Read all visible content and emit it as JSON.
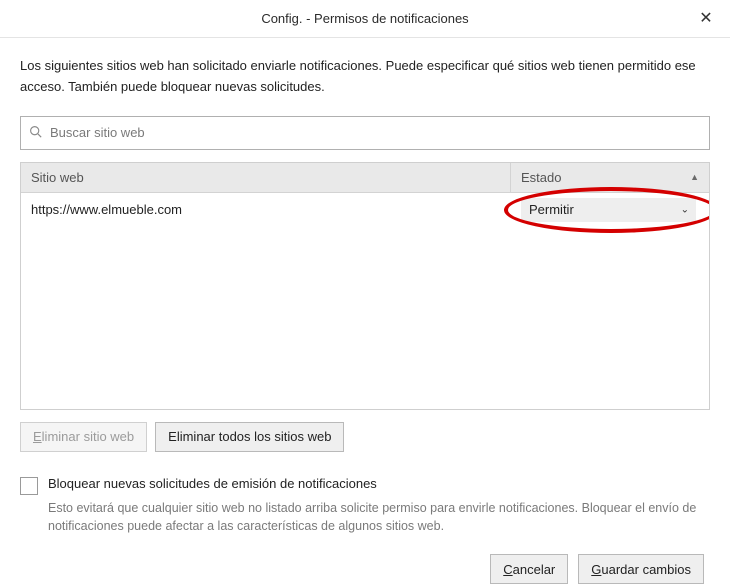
{
  "titlebar": {
    "title": "Config. - Permisos de notificaciones",
    "close": "✕"
  },
  "intro": "Los siguientes sitios web han solicitado enviarle notificaciones. Puede especificar qué sitios web tienen permitido ese acceso. También puede bloquear nuevas solicitudes.",
  "search": {
    "placeholder": "Buscar sitio web"
  },
  "table": {
    "headers": {
      "site": "Sitio web",
      "state": "Estado"
    },
    "rows": [
      {
        "site": "https://www.elmueble.com",
        "state": "Permitir"
      }
    ]
  },
  "buttons": {
    "remove_site_prefix": "E",
    "remove_site_rest": "liminar sitio web",
    "remove_all": "Eliminar todos los sitios web"
  },
  "block_section": {
    "label": "Bloquear nuevas solicitudes de emisión de notificaciones",
    "desc": "Esto evitará que cualquier sitio web no listado arriba solicite permiso para envirle notificaciones. Bloquear el envío de notificaciones puede afectar a las características de algunos sitios web."
  },
  "footer": {
    "cancel_prefix": "C",
    "cancel_rest": "ancelar",
    "save_prefix": "G",
    "save_rest": "uardar cambios"
  }
}
